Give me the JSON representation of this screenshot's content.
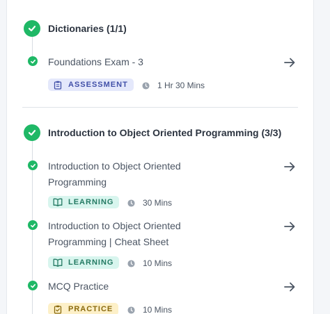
{
  "sections": [
    {
      "title": "Dictionaries (1/1)",
      "items": [
        {
          "title": "Foundations Exam - 3",
          "badge": "ASSESSMENT",
          "badge_icon": "clipboard-icon",
          "duration": "1 Hr 30 Mins"
        }
      ]
    },
    {
      "title": "Introduction to Object Oriented Programming (3/3)",
      "items": [
        {
          "title": "Introduction to Object Oriented Programming",
          "badge": "LEARNING",
          "badge_icon": "book-icon",
          "duration": "30 Mins"
        },
        {
          "title": "Introduction to Object Oriented Programming | Cheat Sheet",
          "badge": "LEARNING",
          "badge_icon": "book-icon",
          "duration": "10 Mins"
        },
        {
          "title": "MCQ Practice",
          "badge": "PRACTICE",
          "badge_icon": "clipboard-check-icon",
          "duration": "10 Mins"
        }
      ]
    }
  ],
  "colors": {
    "completed": "#1fb866",
    "assessment_bg": "#e4e8fb",
    "learning_bg": "#d8f5ee",
    "practice_bg": "#fdf0c8"
  }
}
